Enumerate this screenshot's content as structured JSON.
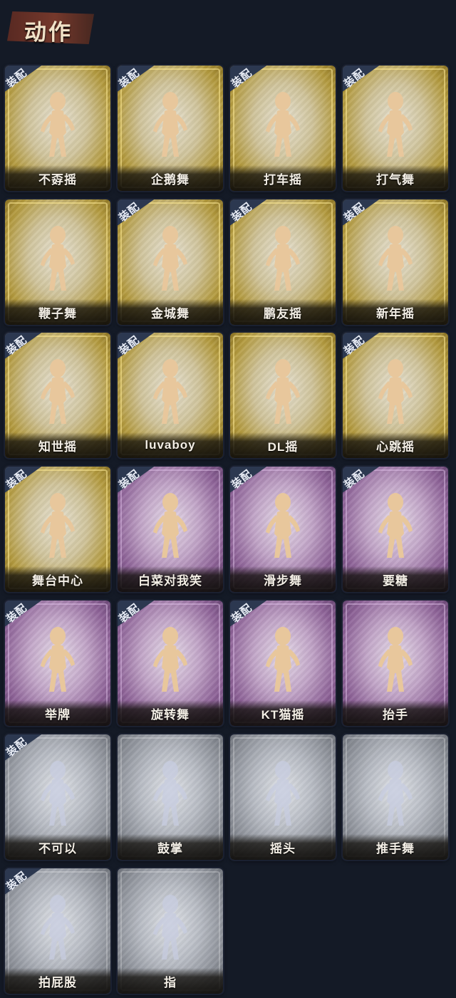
{
  "header": {
    "title": "动作"
  },
  "badge_label": "装配",
  "cards": [
    {
      "label": "不孬摇",
      "tier": "gold",
      "equipped": true,
      "pose": "cheer-music"
    },
    {
      "label": "企鹅舞",
      "tier": "gold",
      "equipped": true,
      "pose": "penguin"
    },
    {
      "label": "打车摇",
      "tier": "gold",
      "equipped": true,
      "pose": "hail-music"
    },
    {
      "label": "打气舞",
      "tier": "gold",
      "equipped": true,
      "pose": "pump"
    },
    {
      "label": "鞭子舞",
      "tier": "gold",
      "equipped": false,
      "pose": "whip"
    },
    {
      "label": "金城舞",
      "tier": "gold",
      "equipped": true,
      "pose": "wave"
    },
    {
      "label": "鹏友摇",
      "tier": "gold",
      "equipped": true,
      "pose": "cross"
    },
    {
      "label": "新年摇",
      "tier": "gold",
      "equipped": true,
      "pose": "newyear"
    },
    {
      "label": "知世摇",
      "tier": "gold",
      "equipped": true,
      "pose": "spread"
    },
    {
      "label": "luvaboy",
      "tier": "gold",
      "equipped": true,
      "pose": "hug"
    },
    {
      "label": "DL摇",
      "tier": "gold",
      "equipped": false,
      "pose": "point-up"
    },
    {
      "label": "心跳摇",
      "tier": "gold",
      "equipped": true,
      "pose": "heartbeat"
    },
    {
      "label": "舞台中心",
      "tier": "gold",
      "equipped": true,
      "pose": "star"
    },
    {
      "label": "白菜对我笑",
      "tier": "purple",
      "equipped": true,
      "pose": "arms-cross"
    },
    {
      "label": "滑步舞",
      "tier": "purple",
      "equipped": true,
      "pose": "slide"
    },
    {
      "label": "要糖",
      "tier": "purple",
      "equipped": true,
      "pose": "ask"
    },
    {
      "label": "举牌",
      "tier": "purple",
      "equipped": true,
      "pose": "sign"
    },
    {
      "label": "旋转舞",
      "tier": "purple",
      "equipped": true,
      "pose": "spin"
    },
    {
      "label": "KT猫摇",
      "tier": "purple",
      "equipped": true,
      "pose": "cat"
    },
    {
      "label": "抬手",
      "tier": "purple",
      "equipped": false,
      "pose": "raise"
    },
    {
      "label": "不可以",
      "tier": "gray",
      "equipped": true,
      "pose": "finger"
    },
    {
      "label": "鼓掌",
      "tier": "gray",
      "equipped": false,
      "pose": "clap"
    },
    {
      "label": "摇头",
      "tier": "gray",
      "equipped": false,
      "pose": "shake"
    },
    {
      "label": "推手舞",
      "tier": "gray",
      "equipped": false,
      "pose": "push"
    },
    {
      "label": "拍屁股",
      "tier": "gray",
      "equipped": true,
      "pose": "spank"
    },
    {
      "label": "指",
      "tier": "gray",
      "equipped": false,
      "pose": "point"
    }
  ],
  "colors": {
    "background": "#141a26",
    "gold_figure": "#e8c79c",
    "purple_figure": "#e8c79c",
    "gray_figure": "#c7cce0",
    "badge": "#2c3850"
  }
}
